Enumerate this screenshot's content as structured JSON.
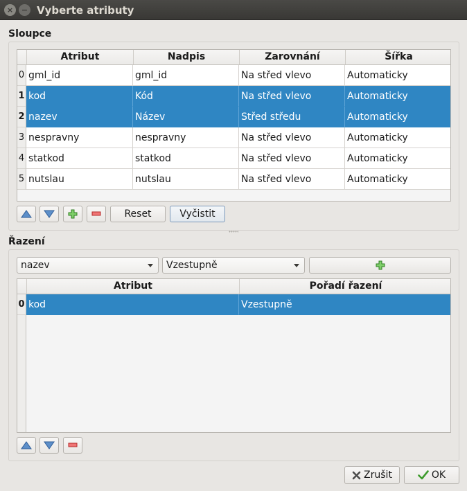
{
  "window": {
    "title": "Vyberte atributy"
  },
  "titlebar": {
    "close_glyph": "×",
    "minimize_glyph": "−"
  },
  "columns_section": {
    "label": "Sloupce",
    "headers": [
      "Atribut",
      "Nadpis",
      "Zarovnání",
      "Šířka"
    ],
    "rows": [
      {
        "index": "0",
        "attribute": "gml_id",
        "caption": "gml_id",
        "alignment": "Na střed vlevo",
        "width": "Automaticky",
        "selected": false
      },
      {
        "index": "1",
        "attribute": "kod",
        "caption": "Kód",
        "alignment": "Na střed vlevo",
        "width": "Automaticky",
        "selected": true
      },
      {
        "index": "2",
        "attribute": "nazev",
        "caption": "Název",
        "alignment": "Střed středu",
        "width": "Automaticky",
        "selected": true
      },
      {
        "index": "3",
        "attribute": "nespravny",
        "caption": "nespravny",
        "alignment": "Na střed vlevo",
        "width": "Automaticky",
        "selected": false
      },
      {
        "index": "4",
        "attribute": "statkod",
        "caption": "statkod",
        "alignment": "Na střed vlevo",
        "width": "Automaticky",
        "selected": false
      },
      {
        "index": "5",
        "attribute": "nutslau",
        "caption": "nutslau",
        "alignment": "Na střed vlevo",
        "width": "Automaticky",
        "selected": false
      }
    ],
    "buttons": {
      "up_icon": "arrow-up-icon",
      "down_icon": "arrow-down-icon",
      "add_icon": "plus-icon",
      "remove_icon": "minus-icon",
      "reset_label": "Reset",
      "clear_label": "Vyčistit"
    }
  },
  "sort_section": {
    "label": "Řazení",
    "attribute_combo": "nazev",
    "order_combo": "Vzestupně",
    "headers": [
      "Atribut",
      "Pořadí řazení"
    ],
    "rows": [
      {
        "index": "0",
        "attribute": "kod",
        "order": "Vzestupně",
        "selected": true
      }
    ]
  },
  "footer": {
    "cancel_label": "Zrušit",
    "ok_label": "OK"
  },
  "colors": {
    "selection": "#2f86c3",
    "titlebar": "#3f3e3b",
    "window_bg": "#e8e6e3",
    "add_green": "#3e9b2d",
    "remove_red": "#d23b3b"
  }
}
